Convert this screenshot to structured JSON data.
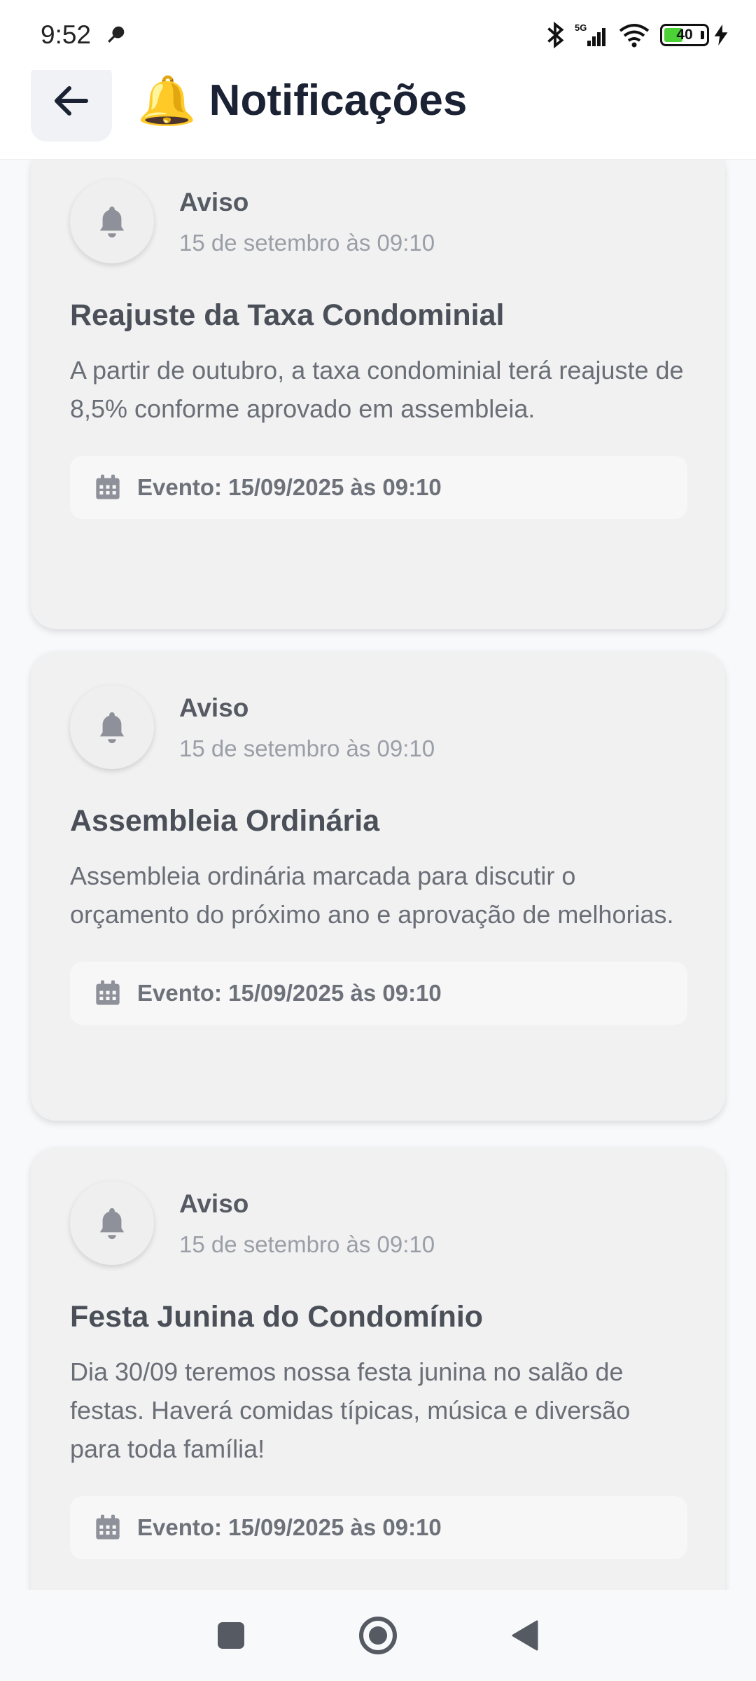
{
  "status_bar": {
    "time": "9:52",
    "network": "5G",
    "battery": "40"
  },
  "header": {
    "emoji": "🔔",
    "title": "Notificações"
  },
  "notifications": [
    {
      "type": "Aviso",
      "date": "15 de setembro às 09:10",
      "title": "Reajuste da Taxa Condominial",
      "body": "A partir de outubro, a taxa condominial terá reajuste de 8,5% conforme aprovado em assembleia.",
      "event": "Evento: 15/09/2025 às 09:10"
    },
    {
      "type": "Aviso",
      "date": "15 de setembro às 09:10",
      "title": "Assembleia Ordinária",
      "body": "Assembleia ordinária marcada para discutir o orçamento do próximo ano e aprovação de melhorias.",
      "event": "Evento: 15/09/2025 às 09:10"
    },
    {
      "type": "Aviso",
      "date": "15 de setembro às 09:10",
      "title": "Festa Junina do Condomínio",
      "body": "Dia 30/09 teremos nossa festa junina no salão de festas. Haverá comidas típicas, música e diversão para toda família!",
      "event": "Evento: 15/09/2025 às 09:10"
    }
  ],
  "colors": {
    "title": "#1b2233",
    "card": "#f1f1f2",
    "battery": "#4cd137"
  }
}
